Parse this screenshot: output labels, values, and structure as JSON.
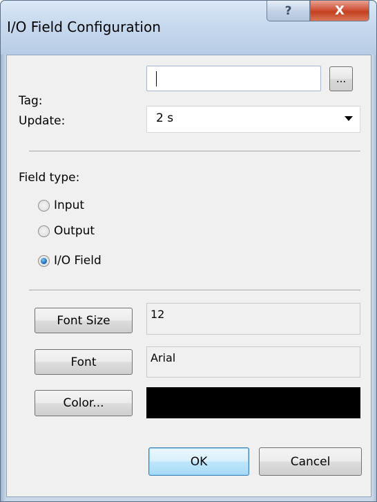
{
  "window": {
    "title": "I/O Field Configuration",
    "help_label": "?",
    "close_label": "X"
  },
  "form": {
    "tag_label": "Tag:",
    "tag_value": "",
    "browse_label": "...",
    "update_label": "Update:",
    "update_value": "2 s",
    "field_type_label": "Field type:",
    "field_types": [
      {
        "label": "Input",
        "checked": false
      },
      {
        "label": "Output",
        "checked": false
      },
      {
        "label": "I/O Field",
        "checked": true
      }
    ],
    "font_size_button": "Font Size",
    "font_size_value": "12",
    "font_button": "Font",
    "font_value": "Arial",
    "color_button": "Color...",
    "color_value": "#000000"
  },
  "buttons": {
    "ok": "OK",
    "cancel": "Cancel"
  },
  "colors": {
    "default_button_border": "#3c7fb1",
    "close_button": "#c4401f"
  }
}
